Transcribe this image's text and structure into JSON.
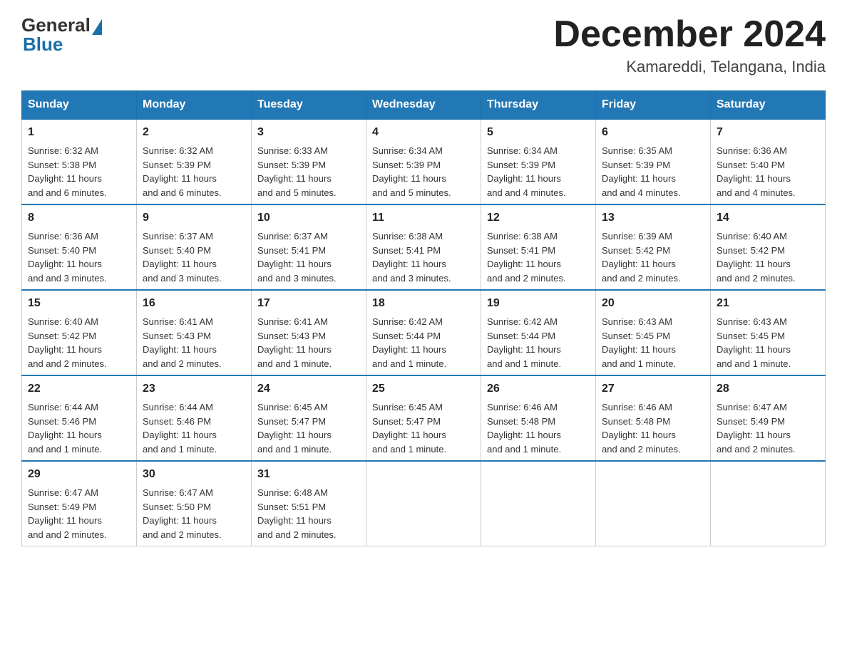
{
  "header": {
    "logo": {
      "general": "General",
      "blue": "Blue"
    },
    "title": "December 2024",
    "location": "Kamareddi, Telangana, India"
  },
  "weekdays": [
    "Sunday",
    "Monday",
    "Tuesday",
    "Wednesday",
    "Thursday",
    "Friday",
    "Saturday"
  ],
  "weeks": [
    [
      {
        "day": "1",
        "sunrise": "6:32 AM",
        "sunset": "5:38 PM",
        "daylight": "11 hours and 6 minutes."
      },
      {
        "day": "2",
        "sunrise": "6:32 AM",
        "sunset": "5:39 PM",
        "daylight": "11 hours and 6 minutes."
      },
      {
        "day": "3",
        "sunrise": "6:33 AM",
        "sunset": "5:39 PM",
        "daylight": "11 hours and 5 minutes."
      },
      {
        "day": "4",
        "sunrise": "6:34 AM",
        "sunset": "5:39 PM",
        "daylight": "11 hours and 5 minutes."
      },
      {
        "day": "5",
        "sunrise": "6:34 AM",
        "sunset": "5:39 PM",
        "daylight": "11 hours and 4 minutes."
      },
      {
        "day": "6",
        "sunrise": "6:35 AM",
        "sunset": "5:39 PM",
        "daylight": "11 hours and 4 minutes."
      },
      {
        "day": "7",
        "sunrise": "6:36 AM",
        "sunset": "5:40 PM",
        "daylight": "11 hours and 4 minutes."
      }
    ],
    [
      {
        "day": "8",
        "sunrise": "6:36 AM",
        "sunset": "5:40 PM",
        "daylight": "11 hours and 3 minutes."
      },
      {
        "day": "9",
        "sunrise": "6:37 AM",
        "sunset": "5:40 PM",
        "daylight": "11 hours and 3 minutes."
      },
      {
        "day": "10",
        "sunrise": "6:37 AM",
        "sunset": "5:41 PM",
        "daylight": "11 hours and 3 minutes."
      },
      {
        "day": "11",
        "sunrise": "6:38 AM",
        "sunset": "5:41 PM",
        "daylight": "11 hours and 3 minutes."
      },
      {
        "day": "12",
        "sunrise": "6:38 AM",
        "sunset": "5:41 PM",
        "daylight": "11 hours and 2 minutes."
      },
      {
        "day": "13",
        "sunrise": "6:39 AM",
        "sunset": "5:42 PM",
        "daylight": "11 hours and 2 minutes."
      },
      {
        "day": "14",
        "sunrise": "6:40 AM",
        "sunset": "5:42 PM",
        "daylight": "11 hours and 2 minutes."
      }
    ],
    [
      {
        "day": "15",
        "sunrise": "6:40 AM",
        "sunset": "5:42 PM",
        "daylight": "11 hours and 2 minutes."
      },
      {
        "day": "16",
        "sunrise": "6:41 AM",
        "sunset": "5:43 PM",
        "daylight": "11 hours and 2 minutes."
      },
      {
        "day": "17",
        "sunrise": "6:41 AM",
        "sunset": "5:43 PM",
        "daylight": "11 hours and 1 minute."
      },
      {
        "day": "18",
        "sunrise": "6:42 AM",
        "sunset": "5:44 PM",
        "daylight": "11 hours and 1 minute."
      },
      {
        "day": "19",
        "sunrise": "6:42 AM",
        "sunset": "5:44 PM",
        "daylight": "11 hours and 1 minute."
      },
      {
        "day": "20",
        "sunrise": "6:43 AM",
        "sunset": "5:45 PM",
        "daylight": "11 hours and 1 minute."
      },
      {
        "day": "21",
        "sunrise": "6:43 AM",
        "sunset": "5:45 PM",
        "daylight": "11 hours and 1 minute."
      }
    ],
    [
      {
        "day": "22",
        "sunrise": "6:44 AM",
        "sunset": "5:46 PM",
        "daylight": "11 hours and 1 minute."
      },
      {
        "day": "23",
        "sunrise": "6:44 AM",
        "sunset": "5:46 PM",
        "daylight": "11 hours and 1 minute."
      },
      {
        "day": "24",
        "sunrise": "6:45 AM",
        "sunset": "5:47 PM",
        "daylight": "11 hours and 1 minute."
      },
      {
        "day": "25",
        "sunrise": "6:45 AM",
        "sunset": "5:47 PM",
        "daylight": "11 hours and 1 minute."
      },
      {
        "day": "26",
        "sunrise": "6:46 AM",
        "sunset": "5:48 PM",
        "daylight": "11 hours and 1 minute."
      },
      {
        "day": "27",
        "sunrise": "6:46 AM",
        "sunset": "5:48 PM",
        "daylight": "11 hours and 2 minutes."
      },
      {
        "day": "28",
        "sunrise": "6:47 AM",
        "sunset": "5:49 PM",
        "daylight": "11 hours and 2 minutes."
      }
    ],
    [
      {
        "day": "29",
        "sunrise": "6:47 AM",
        "sunset": "5:49 PM",
        "daylight": "11 hours and 2 minutes."
      },
      {
        "day": "30",
        "sunrise": "6:47 AM",
        "sunset": "5:50 PM",
        "daylight": "11 hours and 2 minutes."
      },
      {
        "day": "31",
        "sunrise": "6:48 AM",
        "sunset": "5:51 PM",
        "daylight": "11 hours and 2 minutes."
      },
      null,
      null,
      null,
      null
    ]
  ],
  "labels": {
    "sunrise": "Sunrise:",
    "sunset": "Sunset:",
    "daylight": "Daylight:"
  }
}
